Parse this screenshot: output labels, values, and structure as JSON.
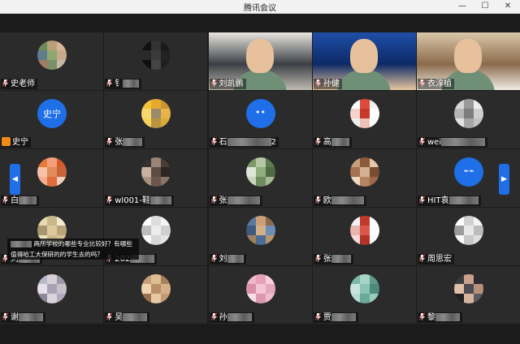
{
  "window": {
    "title": "腾讯会议",
    "minimize": "—",
    "maximize": "☐",
    "close": "✕"
  },
  "participants": [
    {
      "label": "史老师",
      "suffix": "",
      "blur": 0,
      "type": "avatar",
      "colors": [
        "#6b8c5a",
        "#b9a07a",
        "#d4b49c",
        "#5f7d8a",
        "#8fa86e",
        "#c9a98b",
        "#a47b63",
        "#7b8f6a",
        "#c7b8a4"
      ]
    },
    {
      "label": "钅",
      "suffix": "",
      "blur": 20,
      "type": "avatar",
      "colors": [
        "#111111",
        "#333333",
        "#1a1a1a",
        "#2a2a2a",
        "#3a3a3a",
        "#222222",
        "#0f0f0f",
        "#444444",
        "#1f1f1f"
      ]
    },
    {
      "label": "刘凯鹏",
      "suffix": "",
      "blur": 0,
      "type": "video",
      "colors": [
        "#e9e6e0",
        "#3b3f45",
        "#bfbab2"
      ]
    },
    {
      "label": "孙健",
      "suffix": "",
      "blur": 0,
      "type": "video",
      "colors": [
        "#1f4fa8",
        "#0d2a66",
        "#e8c79f"
      ]
    },
    {
      "label": "衣淳植",
      "suffix": "",
      "blur": 0,
      "type": "video",
      "colors": [
        "#d9c7a8",
        "#8b6b4c",
        "#f1ece4"
      ]
    },
    {
      "label": "史宁",
      "suffix": "",
      "blur": 0,
      "type": "blue",
      "text": "史宁"
    },
    {
      "label": "张",
      "suffix": "",
      "blur": 24,
      "type": "avatar",
      "colors": [
        "#f3c63a",
        "#e7a92c",
        "#c9952d",
        "#f6d86b",
        "#9a8a6a",
        "#e8b44a",
        "#f5d35a",
        "#b79343",
        "#d9a93a"
      ]
    },
    {
      "label": "石",
      "suffix": "2",
      "blur": 54,
      "type": "blue",
      "text": "••"
    },
    {
      "label": "高",
      "suffix": "",
      "blur": 22,
      "type": "avatar",
      "colors": [
        "#ffffff",
        "#e04a3a",
        "#f2f2f2",
        "#f5d3cc",
        "#c6382a",
        "#ffffff",
        "#eeeeee",
        "#f0c1b9",
        "#ffffff"
      ]
    },
    {
      "label": "wei",
      "suffix": "",
      "blur": 54,
      "type": "avatar",
      "colors": [
        "#d7d7d7",
        "#9a9a9a",
        "#eeeeee",
        "#b5b5b5",
        "#7d7d7d",
        "#cfcfcf",
        "#e2e2e2",
        "#a6a6a6",
        "#c1c1c1"
      ]
    },
    {
      "label": "白",
      "suffix": "",
      "blur": 22,
      "type": "avatar",
      "colors": [
        "#e97a3c",
        "#f2a07a",
        "#d45a2c",
        "#f6c3a8",
        "#e38a5a",
        "#c9643a",
        "#f4b08c",
        "#e06c3a",
        "#f0d0bc"
      ]
    },
    {
      "label": "wl001-鞋",
      "suffix": "",
      "blur": 26,
      "type": "avatar",
      "colors": [
        "#3a3030",
        "#9a8478",
        "#4a3c36",
        "#c9b2a2",
        "#5e4c44",
        "#2e2626",
        "#a89282",
        "#6a564c",
        "#8a7466"
      ]
    },
    {
      "label": "张",
      "suffix": "",
      "blur": 40,
      "type": "avatar",
      "colors": [
        "#7a9a6a",
        "#b5c7a4",
        "#5c7d4e",
        "#e0e6d8",
        "#8fae7d",
        "#4d6a42",
        "#c9d6bd",
        "#6e8c5f",
        "#a4bb93"
      ]
    },
    {
      "label": "欧",
      "suffix": "",
      "blur": 40,
      "type": "avatar",
      "colors": [
        "#c9a07a",
        "#8b5a3c",
        "#e8c6a8",
        "#a57250",
        "#d4b192",
        "#7a4c30",
        "#f0d8c2",
        "#b58462",
        "#9c6a4a"
      ]
    },
    {
      "label": "HIT袁",
      "suffix": "",
      "blur": 36,
      "type": "blue",
      "text": "⌁⌁"
    },
    {
      "label": "刘",
      "suffix": "",
      "blur": 26,
      "type": "avatar",
      "colors": [
        "#e8d9b0",
        "#c9b98a",
        "#f3ead0",
        "#a89670",
        "#ddc99c",
        "#b9a57a",
        "#efe2bf",
        "#cbb78e",
        "#d6c398"
      ]
    },
    {
      "label": "202",
      "suffix": "",
      "blur": 30,
      "type": "avatar",
      "colors": [
        "#ffffff",
        "#dcdcdc",
        "#f4f4f4",
        "#bdbdbd",
        "#ececec",
        "#cfcfcf",
        "#f9f9f9",
        "#d8d8d8",
        "#e6e6e6"
      ]
    },
    {
      "label": "刘",
      "suffix": "",
      "blur": 20,
      "type": "avatar",
      "colors": [
        "#5a7aa0",
        "#c9a07a",
        "#8a6a4c",
        "#3e5a7d",
        "#d4b08a",
        "#6c8fb5",
        "#a0805e",
        "#4c6c94",
        "#b8946e"
      ]
    },
    {
      "label": "张",
      "suffix": "",
      "blur": 24,
      "type": "avatar",
      "colors": [
        "#f2f2f2",
        "#c0392b",
        "#ffffff",
        "#e8b4ac",
        "#d9574a",
        "#ffffff",
        "#f6dcd8",
        "#b23428",
        "#fafafa"
      ]
    },
    {
      "label": "周思宏",
      "suffix": "",
      "blur": 0,
      "type": "avatar",
      "colors": [
        "#ffffff",
        "#d0d0d0",
        "#f4f4f4",
        "#9c9c9c",
        "#e8e8e8",
        "#bcbcbc",
        "#fafafa",
        "#c8c8c8",
        "#dedede"
      ]
    },
    {
      "label": "谢",
      "suffix": "",
      "blur": 30,
      "type": "avatar",
      "colors": [
        "#b8b8c8",
        "#d8d0d8",
        "#9a98a8",
        "#e8e0e8",
        "#a8a4b4",
        "#c8c0cc",
        "#8c8a9a",
        "#dcd4dc",
        "#b0aabc"
      ]
    },
    {
      "label": "吴",
      "suffix": "",
      "blur": 30,
      "type": "avatar",
      "colors": [
        "#c9a07a",
        "#e0bc92",
        "#a8805a",
        "#f0d4b0",
        "#b8906a",
        "#d6b088",
        "#9a7250",
        "#e8c8a2",
        "#c49a74"
      ]
    },
    {
      "label": "孙",
      "suffix": "",
      "blur": 30,
      "type": "avatar",
      "colors": [
        "#f0b8c8",
        "#e8a0b8",
        "#f8d0dc",
        "#d890a8",
        "#f4c4d2",
        "#e4a8bc",
        "#fadce6",
        "#dc98b0",
        "#f2bccc"
      ]
    },
    {
      "label": "贾",
      "suffix": "",
      "blur": 30,
      "type": "avatar",
      "colors": [
        "#7ab8a8",
        "#a8d4c8",
        "#5c9a8a",
        "#c8e6de",
        "#8ac4b4",
        "#4e8a7a",
        "#b8dcd2",
        "#6aa898",
        "#98ccbe"
      ]
    },
    {
      "label": "黎",
      "suffix": "",
      "blur": 30,
      "type": "avatar",
      "colors": [
        "#3a3a40",
        "#c9a08a",
        "#2a2a30",
        "#e0c0aa",
        "#4a4a52",
        "#b8907a",
        "#1e1e24",
        "#d8b49e",
        "#5a5a62"
      ]
    }
  ],
  "chat_bubble": {
    "sender": "刘",
    "message": "两所学校的哪些专业比较好？有哪些值得哈工大保研的的学生去的吗？"
  }
}
